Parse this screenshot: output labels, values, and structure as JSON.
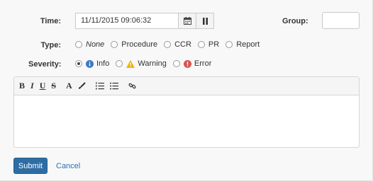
{
  "form": {
    "time_label": "Time:",
    "time_value": "11/11/2015 09:06:32",
    "group_label": "Group:",
    "group_value": "",
    "type_label": "Type:",
    "type_options": [
      "None",
      "Procedure",
      "CCR",
      "PR",
      "Report"
    ],
    "severity_label": "Severity:",
    "severity_options": [
      "Info",
      "Warning",
      "Error"
    ],
    "selected_severity": "Info"
  },
  "toolbar": {
    "bold": "B",
    "italic": "I",
    "underline": "U",
    "strike": "S",
    "font": "A"
  },
  "actions": {
    "submit_label": "Submit",
    "cancel_label": "Cancel"
  },
  "colors": {
    "primary": "#2e6da4",
    "link": "#2a6fb6",
    "info": "#3c78c8",
    "warning": "#f0b400",
    "error": "#d9534f"
  }
}
